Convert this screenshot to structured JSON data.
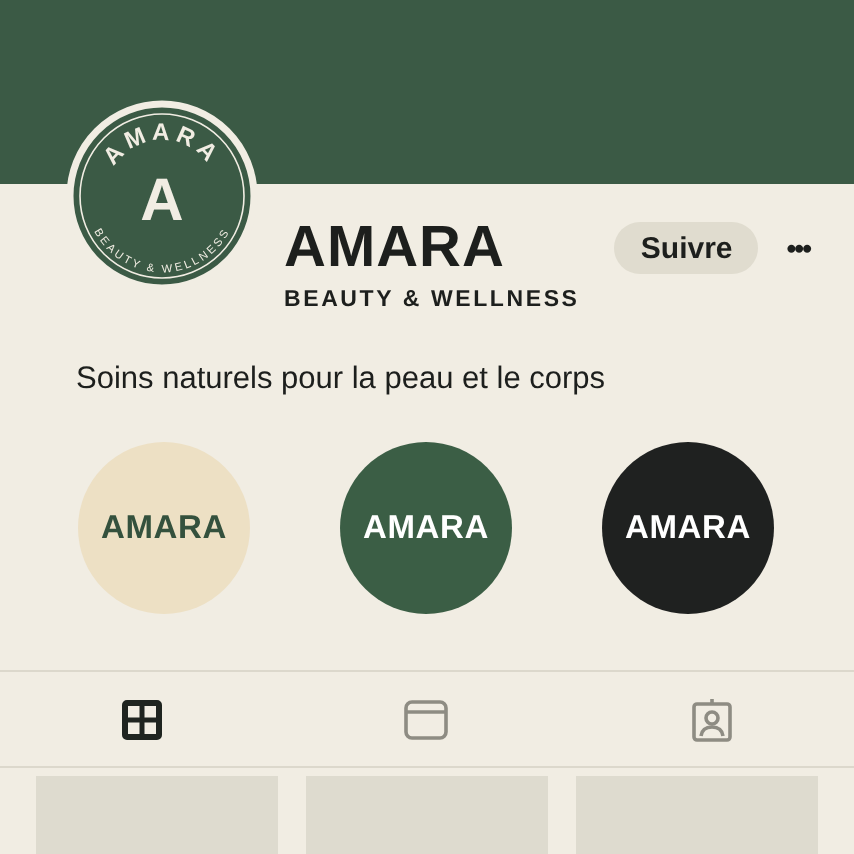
{
  "profile": {
    "logo_title": "AMARA",
    "logo_letter": "A",
    "logo_tagline": "BEAUTY & WELLNESS",
    "name": "AMARA",
    "subtitle": "BEAUTY & WELLNESS",
    "follow_button": "Suivre",
    "more_button": "•••",
    "bio": "Soins naturels pour la peau et le corps"
  },
  "highlights": [
    {
      "label": "AMARA",
      "color": "#ede0c4"
    },
    {
      "label": "AMARA",
      "color": "#3b5e45"
    },
    {
      "label": "AMARA",
      "color": "#1f2120"
    }
  ],
  "tabs": [
    {
      "kind": "grid",
      "selected": true
    },
    {
      "kind": "window",
      "selected": false
    },
    {
      "kind": "person",
      "selected": false
    }
  ],
  "posts": [
    {
      "kind": "tile"
    },
    {
      "kind": "tile"
    },
    {
      "kind": "tile"
    }
  ]
}
